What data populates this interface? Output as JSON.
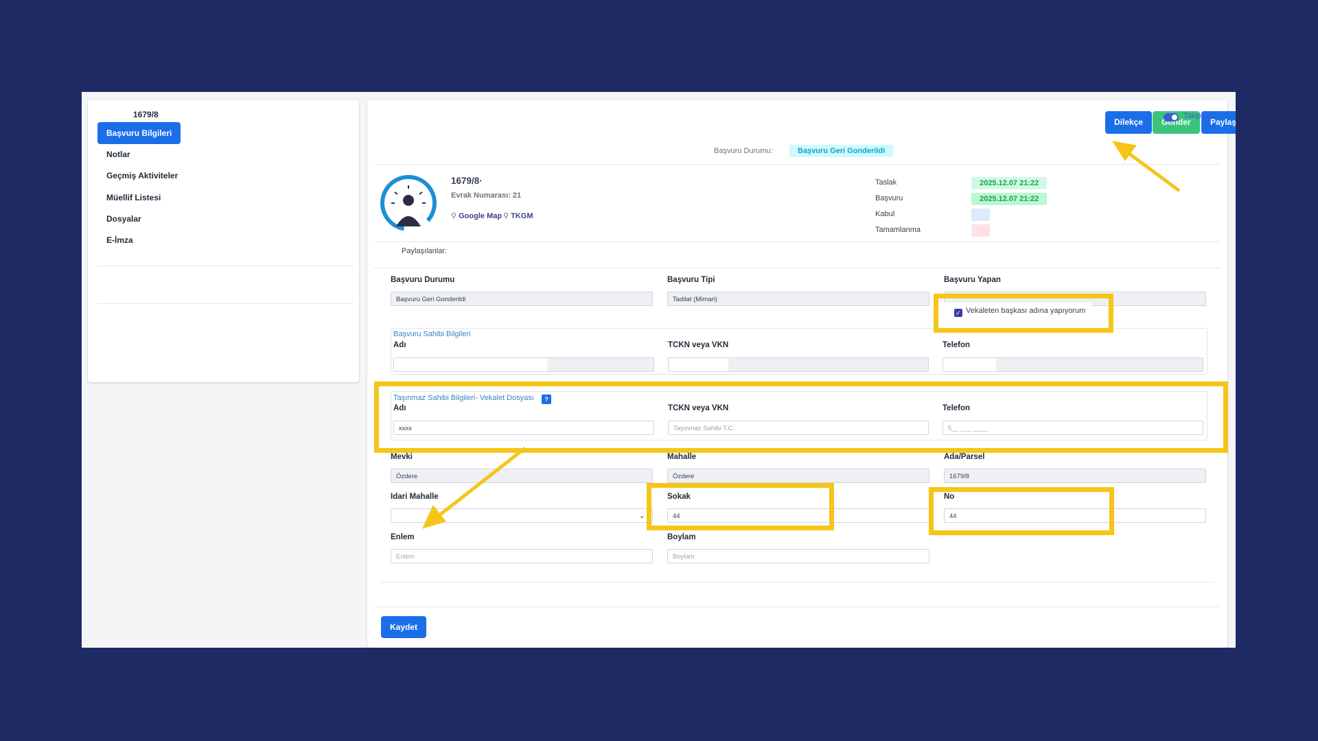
{
  "sidebar": {
    "title": "1679/8",
    "items": [
      "Başvuru Bilgileri",
      "Notlar",
      "Geçmiş Aktiviteler",
      "Müellif Listesi",
      "Dosyalar",
      "E-İmza"
    ]
  },
  "toolbar": {
    "dilekce": "Dilekçe",
    "gonder": "Gönder",
    "paylas": "Paylaş",
    "takip": "Takip Et"
  },
  "status": {
    "label": "Başvuru Durumu:",
    "value": "Başvuru Geri Gonderildi"
  },
  "record": {
    "title": "1679/8·",
    "evrak": "Evrak Numarası: 21",
    "google_map": "Google Map",
    "tkgm": "TKGM",
    "shared_label": "Paylaşılanlar:"
  },
  "timeline": [
    {
      "label": "Taslak",
      "value": "2025.12.07 21:22",
      "color": "#d1fae5"
    },
    {
      "label": "Başvuru",
      "value": "2025.12.07 21:22",
      "color": "#bbf7d0"
    },
    {
      "label": "Kabul",
      "value": "",
      "color": "#dbeafe"
    },
    {
      "label": "Tamamlanma",
      "value": "",
      "color": "#fee2e2"
    }
  ],
  "form": {
    "basvuru_durumu": {
      "label": "Başvuru Durumu",
      "value": "Başvuru Geri Gonderildi"
    },
    "basvuru_tipi": {
      "label": "Başvuru Tipi",
      "value": "Tadilat (Mimari)"
    },
    "basvuru_yapan": {
      "label": "Başvuru Yapan",
      "value": ""
    },
    "vekaleten": {
      "label": "Vekaleten başkası adına yapıyorum",
      "checked": true
    },
    "sahip": {
      "legend": "Başvuru Sahibi Bilgileri",
      "adi": "Adı",
      "tckn": "TCKN veya VKN",
      "telefon": "Telefon"
    },
    "tasinmaz": {
      "legend": "Taşınmaz Sahibi Bilgileri- Vekalet Dosyası",
      "help": "?",
      "adi": "Adı",
      "adi_value": "xxxx",
      "tckn": "TCKN veya VKN",
      "tckn_placeholder": "Taşınmaz Sahibi T.C.",
      "telefon": "Telefon",
      "telefon_placeholder": "5__ ___ ____"
    },
    "mevki": {
      "label": "Mevki",
      "value": "Özdere"
    },
    "mahalle": {
      "label": "Mahalle",
      "value": "Özdere"
    },
    "ada": {
      "label": "Ada/Parsel",
      "value": "1679/8"
    },
    "idari": {
      "label": "Idari Mahalle",
      "value": ""
    },
    "sokak": {
      "label": "Sokak",
      "value": "44"
    },
    "no": {
      "label": "No",
      "value": "44"
    },
    "enlem": {
      "label": "Enlem",
      "placeholder": "Enlem"
    },
    "boylam": {
      "label": "Boylam",
      "placeholder": "Boylam"
    },
    "save": "Kaydet"
  },
  "colors": {
    "accent": "#1a6fe8",
    "send": "#3cc47c",
    "highlight": "#f5c518",
    "background": "#1d2a63"
  }
}
